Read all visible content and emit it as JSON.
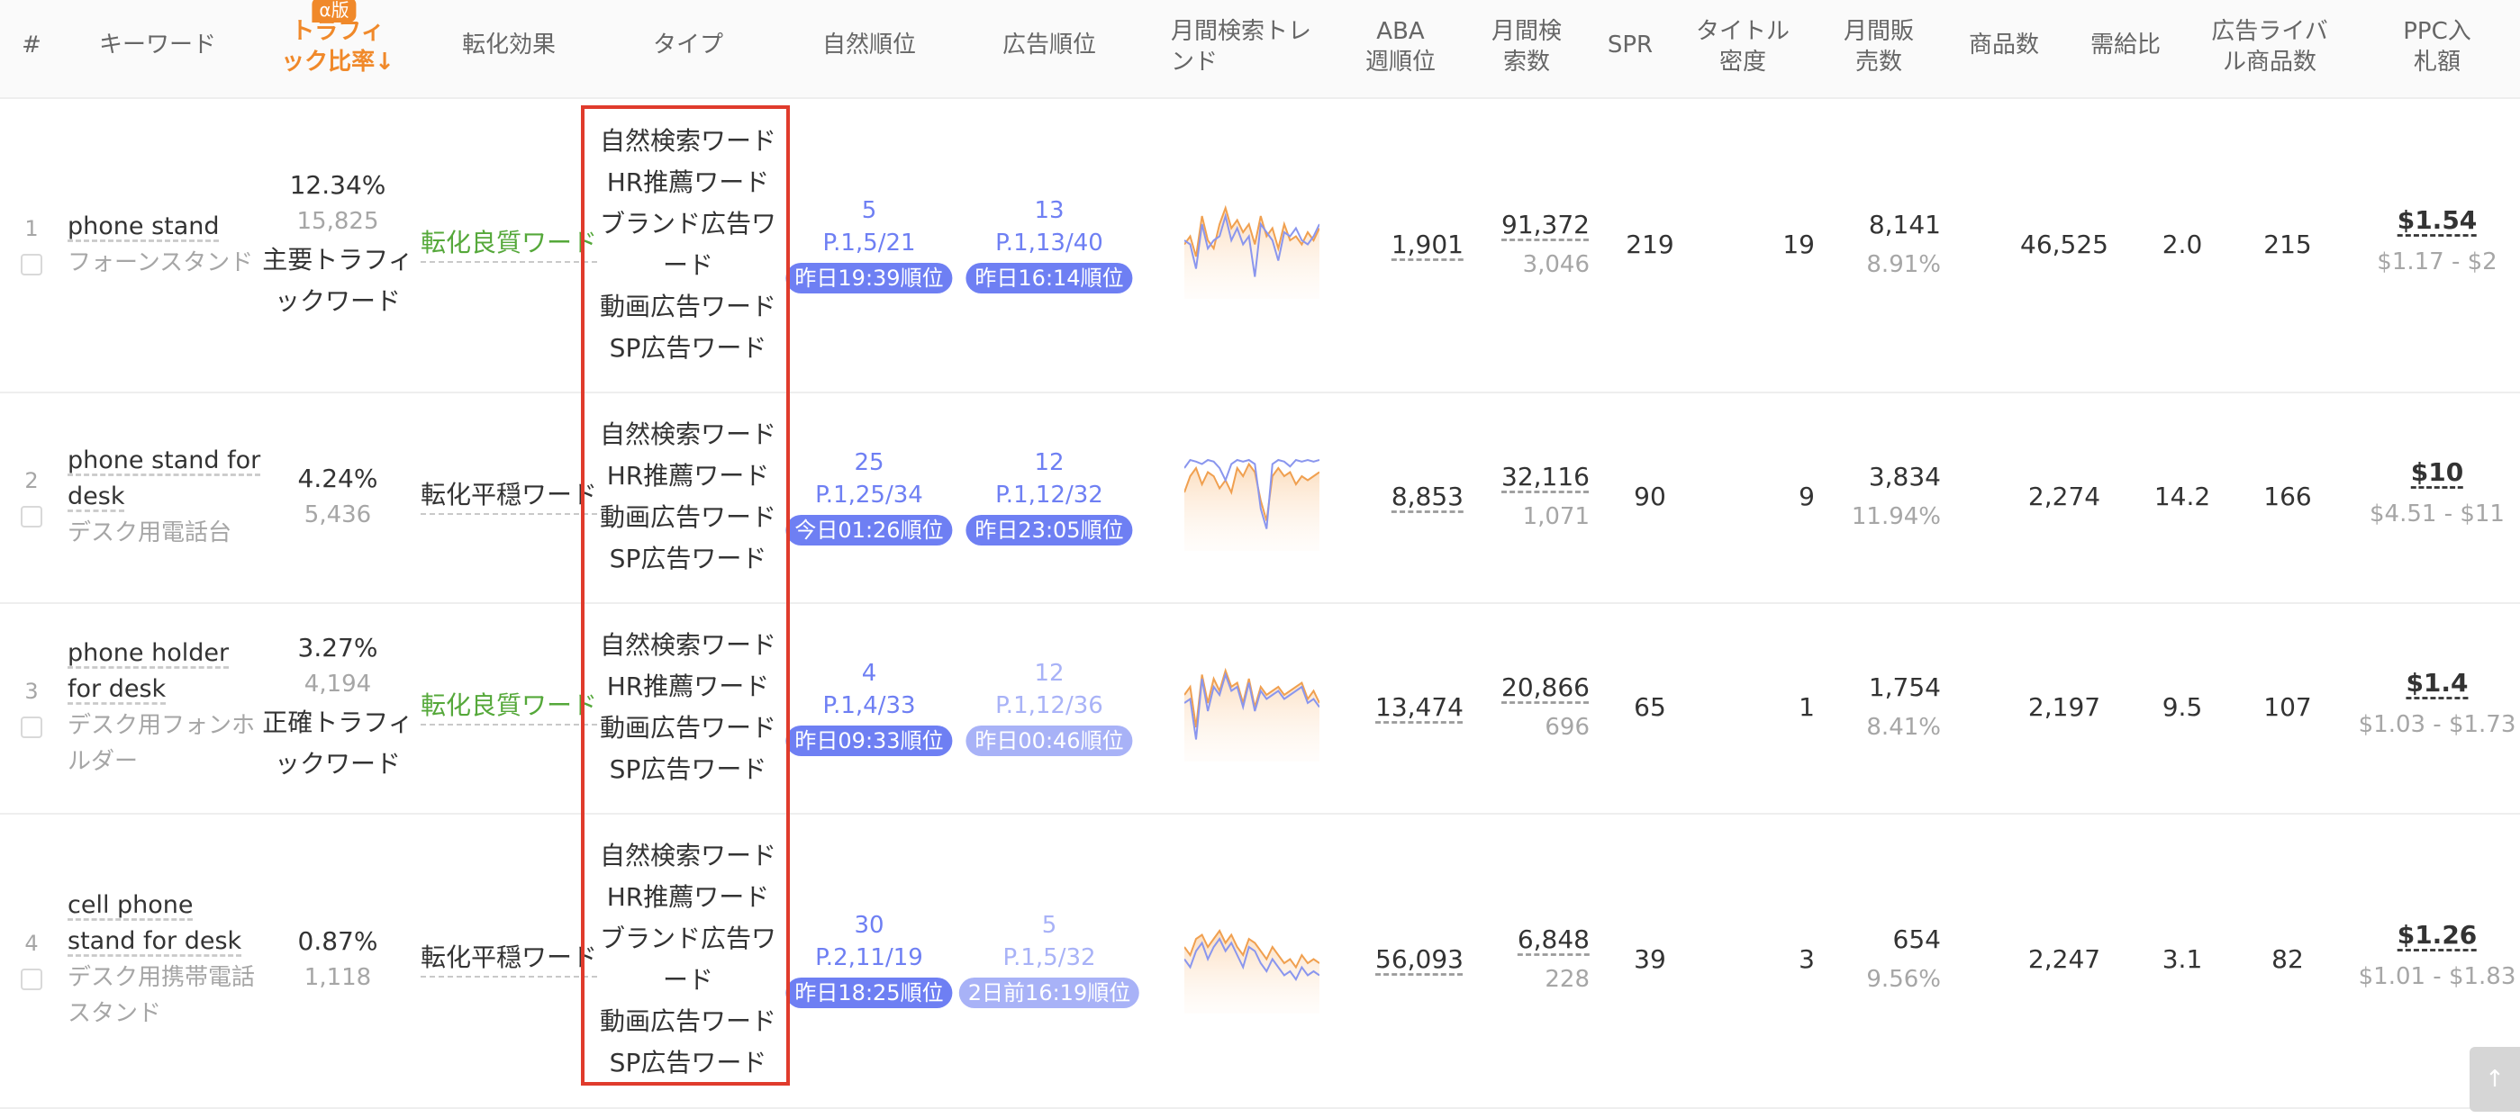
{
  "header": {
    "index": "#",
    "keyword": "キーワード",
    "traffic_line1": "トラフィ",
    "traffic_line2": "ック比率↓",
    "alpha_badge": "α版",
    "conversion": "転化効果",
    "type": "タイプ",
    "organic_rank": "自然順位",
    "ad_rank": "広告順位",
    "trend_line1": "月間検索トレ",
    "trend_line2": "ンド",
    "aba_line1": "ABA",
    "aba_line2": "週順位",
    "monthly_search_line1": "月間検",
    "monthly_search_line2": "索数",
    "spr": "SPR",
    "title_density_line1": "タイトル",
    "title_density_line2": "密度",
    "monthly_sales_line1": "月間販",
    "monthly_sales_line2": "売数",
    "products": "商品数",
    "supply_demand": "需給比",
    "ad_rivals_line1": "広告ライバ",
    "ad_rivals_line2": "ル商品数",
    "ppc_line1": "PPC入",
    "ppc_line2": "札額"
  },
  "rows": [
    {
      "index": "1",
      "keyword_lines": [
        "phone stand"
      ],
      "keyword_jp_lines": [
        "フォーンスタンド"
      ],
      "traffic_pct": "12.34%",
      "traffic_count": "15,825",
      "traffic_label_lines": [
        "主要トラフィ",
        "ックワード"
      ],
      "conversion": "転化良質ワード",
      "conversion_kind": "good",
      "types": [
        "自然検索ワード",
        "HR推薦ワード",
        "ブランド広告ワ",
        "ード",
        "動画広告ワード",
        "SP広告ワード"
      ],
      "organic": {
        "rank": "5",
        "page": "P.1,5/21",
        "badge": "昨日19:39順位",
        "tone": "blue"
      },
      "ad": {
        "rank": "13",
        "page": "P.1,13/40",
        "badge": "昨日16:14順位",
        "tone": "blue"
      },
      "trend": {
        "orange": [
          0.55,
          0.45,
          0.7,
          0.2,
          0.5,
          0.6,
          0.3,
          0.1,
          0.35,
          0.25,
          0.4,
          0.3,
          0.55,
          0.2,
          0.45,
          0.35,
          0.6,
          0.3,
          0.5,
          0.45,
          0.55,
          0.4,
          0.5,
          0.35
        ],
        "blue": [
          0.5,
          0.55,
          0.85,
          0.3,
          0.6,
          0.5,
          0.45,
          0.2,
          0.5,
          0.35,
          0.55,
          0.45,
          0.95,
          0.3,
          0.4,
          0.5,
          0.75,
          0.4,
          0.45,
          0.35,
          0.5,
          0.55,
          0.45,
          0.3
        ]
      },
      "aba": "1,901",
      "monthly_search": "91,372",
      "monthly_search_sub": "3,046",
      "spr": "219",
      "title_density": "19",
      "monthly_sales": "8,141",
      "monthly_sales_pct": "8.91%",
      "products": "46,525",
      "supply_demand": "2.0",
      "ad_rivals": "215",
      "ppc": "$1.54",
      "ppc_range": "$1.17 - $2"
    },
    {
      "index": "2",
      "keyword_lines": [
        "phone stand for",
        "desk"
      ],
      "keyword_jp_lines": [
        "デスク用電話台"
      ],
      "traffic_pct": "4.24%",
      "traffic_count": "5,436",
      "traffic_label_lines": [],
      "conversion": "転化平穏ワード",
      "conversion_kind": "stable",
      "types": [
        "自然検索ワード",
        "HR推薦ワード",
        "動画広告ワード",
        "SP広告ワード"
      ],
      "organic": {
        "rank": "25",
        "page": "P.1,25/34",
        "badge": "今日01:26順位",
        "tone": "blue"
      },
      "ad": {
        "rank": "12",
        "page": "P.1,12/32",
        "badge": "昨日23:05順位",
        "tone": "blue"
      },
      "trend": {
        "orange": [
          0.5,
          0.3,
          0.2,
          0.4,
          0.25,
          0.3,
          0.45,
          0.35,
          0.5,
          0.2,
          0.3,
          0.15,
          0.25,
          0.6,
          0.85,
          0.3,
          0.2,
          0.3,
          0.25,
          0.4,
          0.3,
          0.35,
          0.3,
          0.25
        ],
        "blue": [
          0.2,
          0.1,
          0.12,
          0.15,
          0.1,
          0.12,
          0.2,
          0.35,
          0.15,
          0.1,
          0.12,
          0.1,
          0.15,
          0.7,
          0.95,
          0.15,
          0.1,
          0.12,
          0.18,
          0.1,
          0.12,
          0.1,
          0.12,
          0.1
        ]
      },
      "aba": "8,853",
      "monthly_search": "32,116",
      "monthly_search_sub": "1,071",
      "spr": "90",
      "title_density": "9",
      "monthly_sales": "3,834",
      "monthly_sales_pct": "11.94%",
      "products": "2,274",
      "supply_demand": "14.2",
      "ad_rivals": "166",
      "ppc": "$10",
      "ppc_range": "$4.51 - $11"
    },
    {
      "index": "3",
      "keyword_lines": [
        "phone holder",
        "for desk"
      ],
      "keyword_jp_lines": [
        "デスク用フォンホ",
        "ルダー"
      ],
      "traffic_pct": "3.27%",
      "traffic_count": "4,194",
      "traffic_label_lines": [
        "正確トラフィ",
        "ックワード"
      ],
      "conversion": "転化良質ワード",
      "conversion_kind": "good",
      "types": [
        "自然検索ワード",
        "HR推薦ワード",
        "動画広告ワード",
        "SP広告ワード"
      ],
      "organic": {
        "rank": "4",
        "page": "P.1,4/33",
        "badge": "昨日09:33順位",
        "tone": "blue"
      },
      "ad": {
        "rank": "12",
        "page": "P.1,12/36",
        "badge": "昨日00:46順位",
        "tone": "light"
      },
      "trend": {
        "orange": [
          0.4,
          0.3,
          0.8,
          0.15,
          0.5,
          0.2,
          0.35,
          0.1,
          0.3,
          0.25,
          0.5,
          0.2,
          0.55,
          0.3,
          0.4,
          0.35,
          0.3,
          0.4,
          0.35,
          0.3,
          0.25,
          0.45,
          0.35,
          0.5
        ],
        "blue": [
          0.5,
          0.45,
          0.95,
          0.2,
          0.6,
          0.3,
          0.4,
          0.15,
          0.35,
          0.3,
          0.55,
          0.25,
          0.6,
          0.35,
          0.45,
          0.4,
          0.35,
          0.45,
          0.4,
          0.35,
          0.3,
          0.5,
          0.45,
          0.55
        ]
      },
      "aba": "13,474",
      "monthly_search": "20,866",
      "monthly_search_sub": "696",
      "spr": "65",
      "title_density": "1",
      "monthly_sales": "1,754",
      "monthly_sales_pct": "8.41%",
      "products": "2,197",
      "supply_demand": "9.5",
      "ad_rivals": "107",
      "ppc": "$1.4",
      "ppc_range": "$1.03 - $1.73"
    },
    {
      "index": "4",
      "keyword_lines": [
        "cell phone",
        "stand for desk"
      ],
      "keyword_jp_lines": [
        "デスク用携帯電話",
        "スタンド"
      ],
      "traffic_pct": "0.87%",
      "traffic_count": "1,118",
      "traffic_label_lines": [],
      "conversion": "転化平穏ワード",
      "conversion_kind": "stable",
      "types": [
        "自然検索ワード",
        "HR推薦ワード",
        "ブランド広告ワ",
        "ード",
        "動画広告ワード",
        "SP広告ワード"
      ],
      "organic": {
        "rank": "30",
        "page": "P.2,11/19",
        "badge": "昨日18:25順位",
        "tone": "blue"
      },
      "ad": {
        "rank": "5",
        "page": "P.1,5/32",
        "badge": "2日前16:19順位",
        "tone": "light"
      },
      "trend": {
        "orange": [
          0.4,
          0.5,
          0.3,
          0.25,
          0.4,
          0.3,
          0.2,
          0.35,
          0.25,
          0.4,
          0.5,
          0.3,
          0.35,
          0.45,
          0.55,
          0.4,
          0.5,
          0.6,
          0.55,
          0.65,
          0.5,
          0.6,
          0.55,
          0.6
        ],
        "blue": [
          0.55,
          0.65,
          0.45,
          0.35,
          0.55,
          0.4,
          0.3,
          0.45,
          0.35,
          0.5,
          0.65,
          0.4,
          0.45,
          0.6,
          0.7,
          0.55,
          0.65,
          0.75,
          0.7,
          0.8,
          0.65,
          0.75,
          0.7,
          0.75
        ]
      },
      "aba": "56,093",
      "monthly_search": "6,848",
      "monthly_search_sub": "228",
      "spr": "39",
      "title_density": "3",
      "monthly_sales": "654",
      "monthly_sales_pct": "9.56%",
      "products": "2,247",
      "supply_demand": "3.1",
      "ad_rivals": "82",
      "ppc": "$1.26",
      "ppc_range": "$1.01 - $1.83"
    }
  ],
  "colors": {
    "accent_orange": "#f0892a",
    "rank_blue": "#6e7ff3",
    "rank_light": "#a8b2f7",
    "good_green": "#55a83a",
    "highlight_red": "#e03b2c",
    "trend_orange": "#f0a050",
    "trend_blue": "#8a96ee"
  },
  "icons": {
    "scroll_top": "arrow-up-icon"
  },
  "scroll_top_glyph": "↑"
}
